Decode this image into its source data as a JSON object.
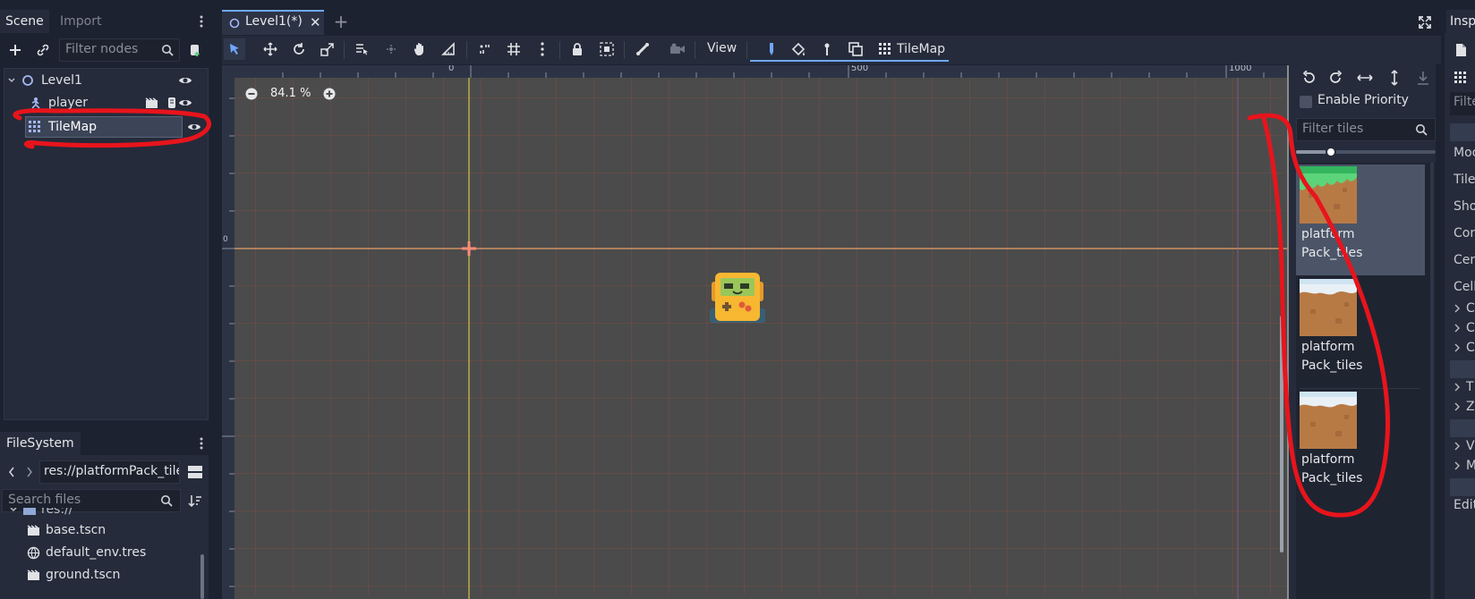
{
  "scene_dock": {
    "tab_scene": "Scene",
    "tab_import": "Import",
    "filter_placeholder": "Filter nodes",
    "nodes": [
      {
        "name": "Level1",
        "type": "node2d"
      },
      {
        "name": "player",
        "type": "kinematic"
      },
      {
        "name": "TileMap",
        "type": "tilemap",
        "selected": true
      }
    ]
  },
  "filesystem_dock": {
    "title": "FileSystem",
    "path": "res://platformPack_tile",
    "search_placeholder": "Search files",
    "root": "res://",
    "files": [
      {
        "name": "base.tscn",
        "icon": "scene-icon"
      },
      {
        "name": "default_env.tres",
        "icon": "environment-icon"
      },
      {
        "name": "ground.tscn",
        "icon": "scene-icon"
      }
    ]
  },
  "editor_tabs": {
    "active_tab": "Level1(*)",
    "close_symbol": "✕",
    "add_symbol": "+"
  },
  "toolbar": {
    "view_label": "View",
    "tilemap_label": "TileMap"
  },
  "viewport": {
    "zoom": "84.1 %",
    "ruler_labels": [
      "0",
      "500",
      "1000"
    ],
    "vruler_label": "0"
  },
  "tile_panel": {
    "enable_priority": "Enable Priority",
    "filter_placeholder": "Filter tiles",
    "zoom_slider_fraction": 0.25,
    "tiles": [
      {
        "line1": "platform",
        "line2": "Pack_tiles",
        "style": "grass",
        "selected": true
      },
      {
        "line1": "platform",
        "line2": "Pack_tiles",
        "style": "snow",
        "selected": false
      },
      {
        "line1": "platform",
        "line2": "Pack_tiles",
        "style": "snow",
        "selected": false
      }
    ]
  },
  "inspector": {
    "tab": "Insp",
    "filter": "Filte",
    "props": [
      "Moc",
      "Tile",
      "Sho",
      "Con",
      "Cen",
      "Cell"
    ],
    "groups": [
      "C",
      "C",
      "C",
      "T",
      "Z",
      "V",
      "M"
    ],
    "footer": "Edit"
  },
  "colors": {
    "accent": "#6fa8ff",
    "annotation": "#e8141c",
    "viewport_bg": "#4b4b4b",
    "panel_bg": "#252b3a"
  }
}
